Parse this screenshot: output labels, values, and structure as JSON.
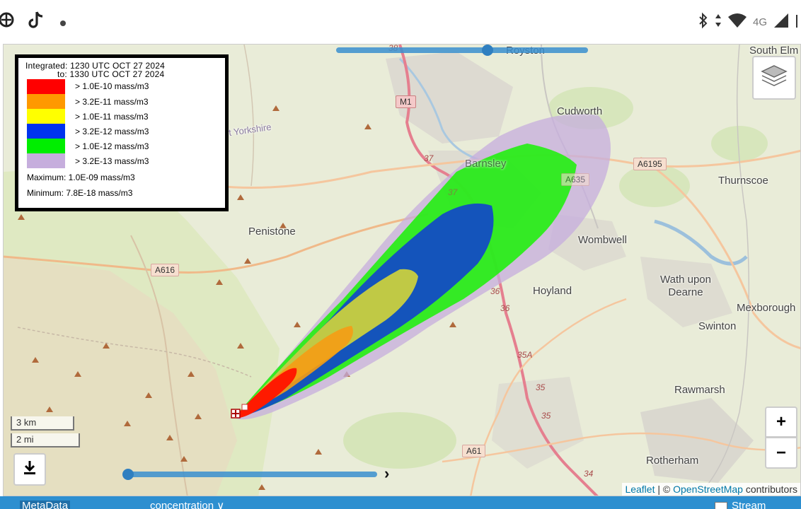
{
  "statusbar": {
    "network": "4G"
  },
  "map": {
    "places": [
      {
        "name": "Royston"
      },
      {
        "name": "South Elm"
      },
      {
        "name": "Cudworth"
      },
      {
        "name": "Barnsley"
      },
      {
        "name": "Thurnscoe"
      },
      {
        "name": "Penistone"
      },
      {
        "name": "Wombwell"
      },
      {
        "name": "Hoyland"
      },
      {
        "name": "Wath upon\nDearne"
      },
      {
        "name": "Mexborough"
      },
      {
        "name": "Swinton"
      },
      {
        "name": "Rawmarsh"
      },
      {
        "name": "Rotherham"
      },
      {
        "name": "t Yorkshire"
      }
    ],
    "roads": [
      {
        "name": "M1",
        "motorway": true
      },
      {
        "name": "A6195",
        "motorway": false
      },
      {
        "name": "A635",
        "motorway": false
      },
      {
        "name": "A616",
        "motorway": false
      },
      {
        "name": "A61",
        "motorway": false
      }
    ],
    "junctions": [
      "38",
      "37",
      "37",
      "36",
      "36",
      "35A",
      "35",
      "35",
      "34"
    ]
  },
  "legend": {
    "integrated_label": "Integrated:",
    "from_time": "1230 UTC  OCT  27  2024",
    "to_label": "to:",
    "to_time": "1330 UTC  OCT  27  2024",
    "entries": [
      {
        "color": "#ff0000",
        "label": "> 1.0E-10  mass/m3"
      },
      {
        "color": "#ff9900",
        "label": "> 3.2E-11  mass/m3"
      },
      {
        "color": "#ffff00",
        "label": "> 1.0E-11  mass/m3"
      },
      {
        "color": "#0033ee",
        "label": "> 3.2E-12  mass/m3"
      },
      {
        "color": "#00ee00",
        "label": "> 1.0E-12  mass/m3"
      },
      {
        "color": "#c6aedd",
        "label": "> 3.2E-13  mass/m3"
      }
    ],
    "maximum": "Maximum: 1.0E-09  mass/m3",
    "minimum": "Minimum: 7.8E-18  mass/m3"
  },
  "scale": {
    "metric": "3 km",
    "imperial": "2 mi"
  },
  "controls": {
    "zoom_in": "+",
    "zoom_out": "−",
    "next": "›"
  },
  "time_slider": {
    "position": 0.0
  },
  "top_slider": {
    "position": 0.6
  },
  "attribution": {
    "leaflet": "Leaflet",
    "separator": " | © ",
    "osm": "OpenStreetMap",
    "suffix": " contributors"
  },
  "bottombar": {
    "tab_label": "MetaData",
    "select_label": "concentration  ∨",
    "checkbox_label": "Stream"
  }
}
